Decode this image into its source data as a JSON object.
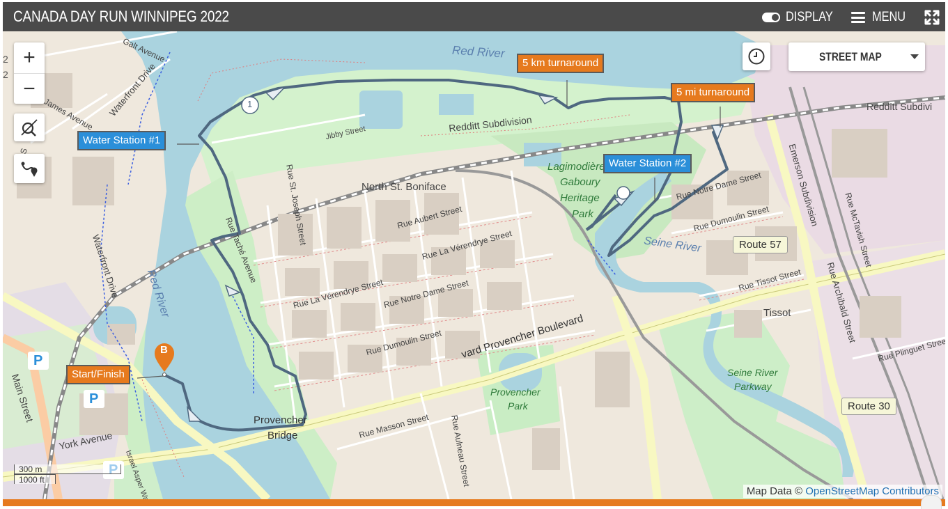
{
  "header": {
    "title": "CANADA DAY RUN WINNIPEG 2022",
    "display_label": "DISPLAY",
    "menu_label": "MENU"
  },
  "controls": {
    "zoom_in": "+",
    "zoom_out": "−",
    "base_layer": "STREET MAP"
  },
  "map": {
    "route_markers": [
      {
        "label": "5 km turnaround",
        "style": "orange"
      },
      {
        "label": "5 mi turnaround",
        "style": "orange"
      },
      {
        "label": "Water Station #1",
        "style": "blue"
      },
      {
        "label": "Water Station #2",
        "style": "blue"
      },
      {
        "label": "Start/Finish",
        "style": "orange"
      }
    ],
    "pin_letter": "B",
    "km_marker": "1",
    "place_labels": {
      "red_river_north": "Red River",
      "red_river_south": "Red River",
      "seine_river": "Seine River",
      "north_st_boniface": "North St. Boniface",
      "park_lagimodiere": "Lagimodière",
      "park_gaboury": "Gaboury",
      "park_heritage": "Heritage",
      "park_park": "Park",
      "tissot": "Tissot",
      "provencher_park_1": "Provencher",
      "provencher_park_2": "Park",
      "seine_parkway_1": "Seine River",
      "seine_parkway_2": "Parkway",
      "provencher_bridge_1": "Provencher",
      "provencher_bridge_2": "Bridge"
    },
    "street_labels": {
      "galt_avenue": "Galt Avenue",
      "waterfront_drive_n": "Waterfront Drive",
      "james_avenue": "James Avenue",
      "waterfront_drive_s": "Waterfront Drive",
      "jibby_street": "Jibby Street",
      "redditt_subdivision": "Redditt Subdivision",
      "redditt_subdiv_east": "Redditt Subdivi",
      "rue_st_joseph": "Rue St. Joseph Street",
      "rue_aubert": "Rue Aubert Street",
      "rue_la_verendrye_1": "Rue La Vérendrye Street",
      "rue_la_verendrye_2": "Rue La Vérendrye Street",
      "rue_notre_dame_1": "Rue Notre Dame Street",
      "rue_notre_dame_2": "Rue Notre Dame Street",
      "rue_dumoulin_1": "Rue Dumoulin Street",
      "rue_dumoulin_2": "Rue Dumoulin Street",
      "rue_tache": "Rue Taché Avenue",
      "provencher_blvd": "vard Provencher Boulevard",
      "rue_masson": "Rue Masson Street",
      "rue_aulneau": "Rue Aulneau Street",
      "rue_tissot": "Rue Tissot Street",
      "rue_archibald": "Rue Archibald Street",
      "rue_mctavish": "Rue McTavish Street",
      "emerson_subdivision": "Emerson Subdivision",
      "rue_plinguet": "Rue Plinguet Street",
      "york_avenue": "York Avenue",
      "main_street": "Main Street",
      "israel_asper": "Israel Asper Wa",
      "rorie": "Rorie S"
    },
    "route_shields": {
      "route_57": "Route 57",
      "route_30": "Route 30"
    },
    "edge_fragments": [
      "2",
      "2"
    ],
    "parking_symbol": "P"
  },
  "scale": {
    "metric": "300 m",
    "imperial": "1000 ft"
  },
  "attribution": {
    "prefix": "Map Data © ",
    "link": "OpenStreetMap Contributors"
  },
  "playback": {
    "progress_fraction": 1.0
  },
  "colors": {
    "header_bg": "#4a4a4a",
    "accent_orange": "#e67a1e",
    "station_blue": "#2b8fd9",
    "route_line": "#4f6880",
    "river": "#aad3df",
    "park": "#c8facc"
  }
}
